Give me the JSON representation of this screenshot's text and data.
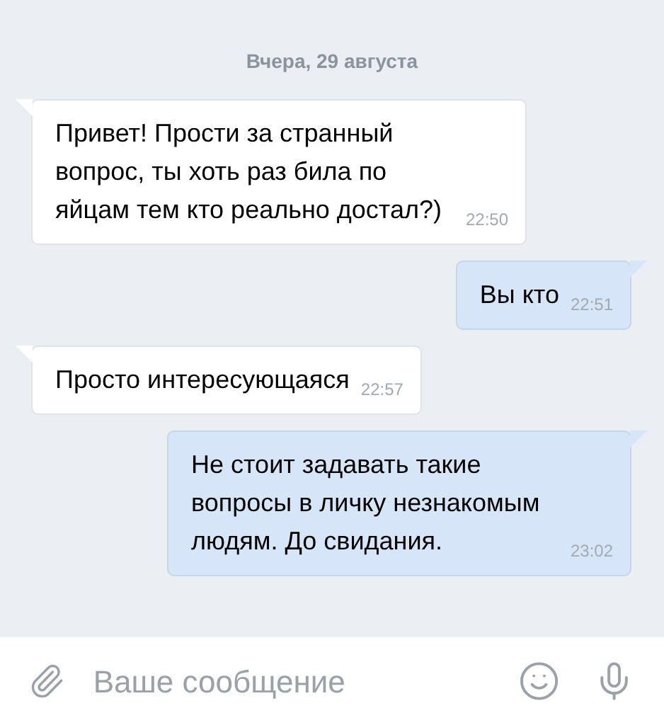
{
  "date_divider": "Вчера, 29 августа",
  "messages": [
    {
      "kind": "incoming",
      "text": "Привет! Прости за странный вопрос, ты хоть раз била по яйцам тем кто реально достал?)",
      "time": "22:50"
    },
    {
      "kind": "outgoing",
      "text": "Вы кто",
      "time": "22:51"
    },
    {
      "kind": "incoming",
      "text": "Просто интересующаяся",
      "time": "22:57"
    },
    {
      "kind": "outgoing",
      "text": "Не стоит задавать такие вопросы в личку незнакомым людям. До свидания.",
      "time": "23:02"
    }
  ],
  "composer": {
    "placeholder": "Ваше сообщение"
  }
}
